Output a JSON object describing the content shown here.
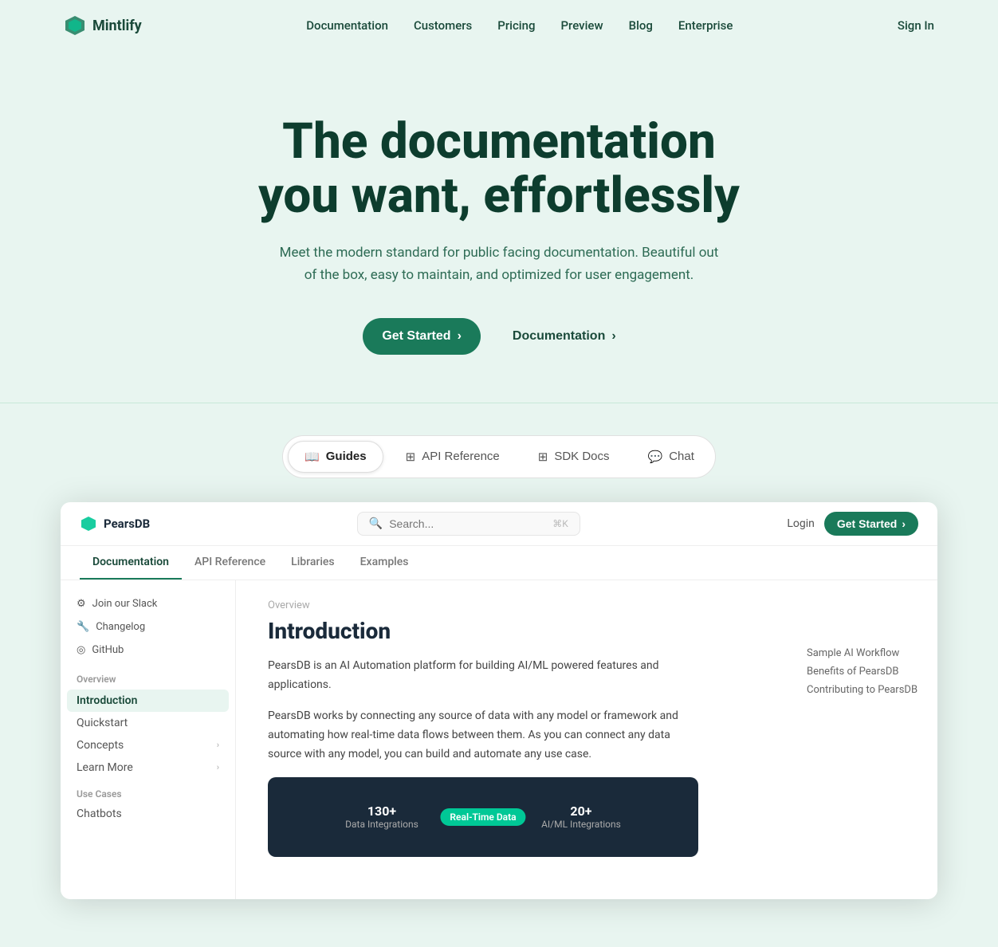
{
  "nav": {
    "logo_text": "Mintlify",
    "links": [
      "Documentation",
      "Customers",
      "Pricing",
      "Preview",
      "Blog",
      "Enterprise"
    ],
    "signin": "Sign In"
  },
  "hero": {
    "headline_line1": "The documentation",
    "headline_line2": "you want, effortlessly",
    "subtext": "Meet the modern standard for public facing documentation. Beautiful out of the box, easy to maintain, and optimized for user engagement.",
    "btn_primary": "Get Started",
    "btn_primary_arrow": "›",
    "btn_secondary": "Documentation",
    "btn_secondary_arrow": "›"
  },
  "tabs": [
    {
      "id": "guides",
      "label": "Guides",
      "icon": "book"
    },
    {
      "id": "api-reference",
      "label": "API Reference",
      "icon": "code"
    },
    {
      "id": "sdk-docs",
      "label": "SDK Docs",
      "icon": "grid"
    },
    {
      "id": "chat",
      "label": "Chat",
      "icon": "chat"
    }
  ],
  "demo": {
    "logo": "PearsDB",
    "search_placeholder": "Search...",
    "search_shortcut": "⌘K",
    "login": "Login",
    "get_started": "Get Started",
    "get_started_arrow": "›",
    "nav_tabs": [
      "Documentation",
      "API Reference",
      "Libraries",
      "Examples"
    ],
    "sidebar": {
      "utility_items": [
        "Join our Slack",
        "Changelog",
        "GitHub"
      ],
      "utility_icons": [
        "⚙",
        "🔧",
        "◎"
      ],
      "overview_section": "Overview",
      "overview_items": [
        {
          "label": "Introduction",
          "active": true
        },
        {
          "label": "Quickstart",
          "active": false
        },
        {
          "label": "Concepts",
          "active": false,
          "arrow": true
        },
        {
          "label": "Learn More",
          "active": false,
          "arrow": true
        }
      ],
      "use_cases_section": "Use Cases",
      "use_cases_items": [
        "Chatbots"
      ]
    },
    "main": {
      "breadcrumb": "Overview",
      "title": "Introduction",
      "text1": "PearsDB is an AI Automation platform for building AI/ML powered features and applications.",
      "text2": "PearsDB works by connecting any source of data with any model or framework and automating how real-time data flows between them. As you can connect any data source with any model, you can build and automate any use case.",
      "image": {
        "left_stat_label": "Data Integrations",
        "left_stat_value": "130+",
        "pill": "Real-Time Data",
        "right_stat_label": "AI/ML Integrations",
        "right_stat_value": "20+"
      }
    },
    "toc": {
      "items": [
        "Sample AI Workflow",
        "Benefits of PearsDB",
        "Contributing to PearsDB"
      ]
    }
  }
}
